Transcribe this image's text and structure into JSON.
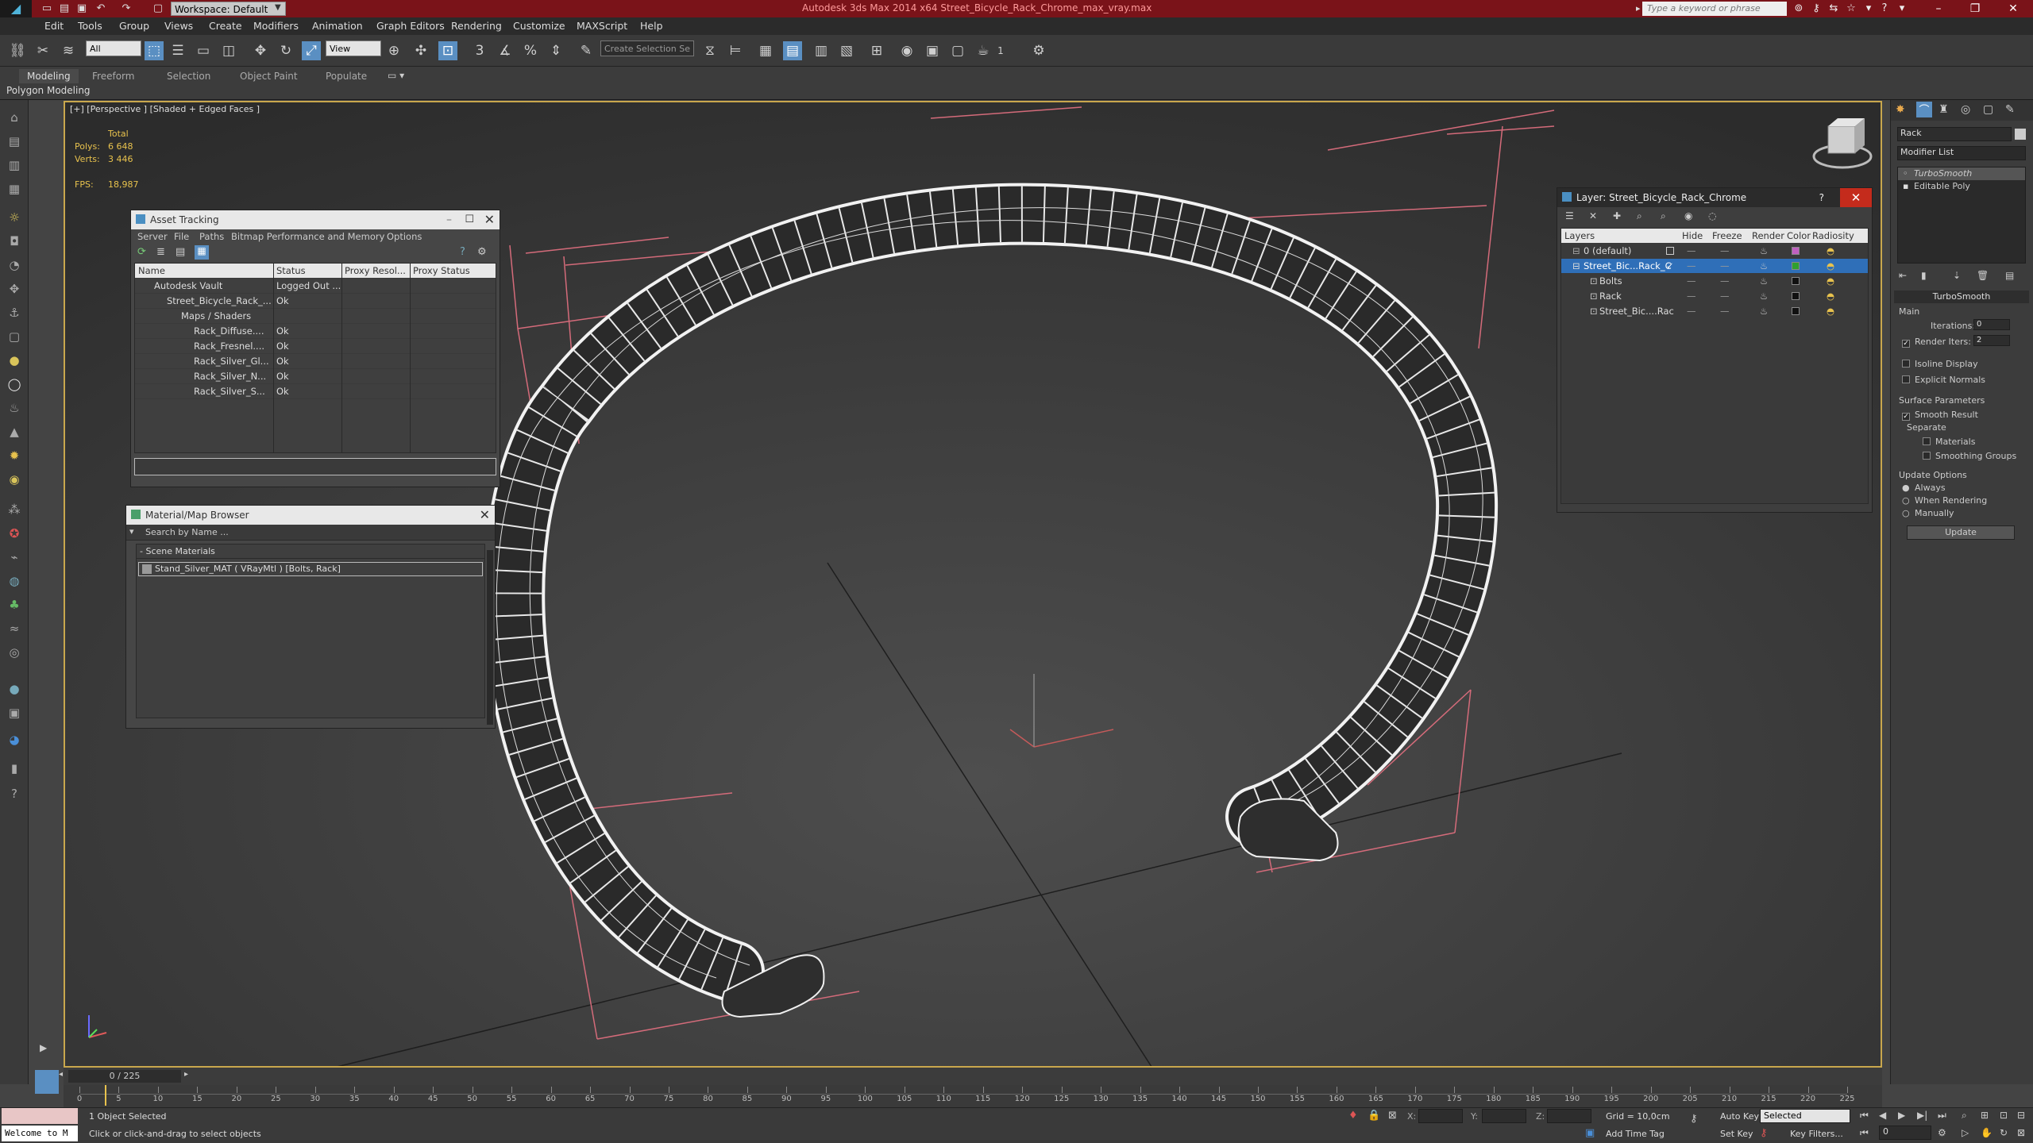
{
  "app": {
    "window_title": "Autodesk 3ds Max  2014 x64      Street_Bicycle_Rack_Chrome_max_vray.max",
    "workspace": "Workspace: Default",
    "search_placeholder": "Type a keyword or phrase"
  },
  "menu": [
    "Edit",
    "Tools",
    "Group",
    "Views",
    "Create",
    "Modifiers",
    "Animation",
    "Graph Editors",
    "Rendering",
    "Customize",
    "MAXScript",
    "Help"
  ],
  "toolbar": {
    "selection_filter": "All",
    "ref_coord": "View",
    "selection_set": "Create Selection Se",
    "snap_toggle": "3",
    "angle_snap": "%",
    "count": "1"
  },
  "ribbon": {
    "tabs": [
      "Modeling",
      "Freeform",
      "Selection",
      "Object Paint",
      "Populate"
    ],
    "sub_label": "Polygon Modeling"
  },
  "viewport": {
    "label": "[+] [Perspective ] [Shaded + Edged Faces ]",
    "stats": {
      "total_label": "Total",
      "polys_label": "Polys:",
      "polys_value": "6 648",
      "verts_label": "Verts:",
      "verts_value": "3 446",
      "fps_label": "FPS:",
      "fps_value": "18,987"
    }
  },
  "asset_tracking": {
    "title": "Asset Tracking",
    "menu": [
      "Server",
      "File",
      "Paths",
      "Bitmap Performance and Memory",
      "Options"
    ],
    "columns": [
      "Name",
      "Status",
      "Proxy Resol...",
      "Proxy Status"
    ],
    "rows": [
      {
        "name": "Autodesk Vault",
        "status": "Logged Out ..."
      },
      {
        "name": "Street_Bicycle_Rack_...",
        "status": "Ok"
      },
      {
        "name": "Maps / Shaders",
        "status": ""
      },
      {
        "name": "Rack_Diffuse....",
        "status": "Ok"
      },
      {
        "name": "Rack_Fresnel....",
        "status": "Ok"
      },
      {
        "name": "Rack_Silver_Gl...",
        "status": "Ok"
      },
      {
        "name": "Rack_Silver_N...",
        "status": "Ok"
      },
      {
        "name": "Rack_Silver_S...",
        "status": "Ok"
      }
    ]
  },
  "material_browser": {
    "title": "Material/Map Browser",
    "search_placeholder": "Search by Name ...",
    "group": "- Scene Materials",
    "item": "Stand_Silver_MAT  ( VRayMtl )  [Bolts, Rack]"
  },
  "layer_manager": {
    "title": "Layer: Street_Bicycle_Rack_Chrome",
    "help": "?",
    "columns": [
      "Layers",
      "Hide",
      "Freeze",
      "Render",
      "Color",
      "Radiosity"
    ],
    "rows": [
      {
        "name": "0 (default)",
        "color": "#c060c0"
      },
      {
        "name": "Street_Bic...Rack_C",
        "color": "#2fa02f"
      },
      {
        "name": "Bolts",
        "color": "#111111"
      },
      {
        "name": "Rack",
        "color": "#111111"
      },
      {
        "name": "Street_Bic....Rac",
        "color": "#111111"
      }
    ]
  },
  "command_panel": {
    "object_name": "Rack",
    "modifier_list": "Modifier List",
    "stack": [
      "TurboSmooth",
      "Editable Poly"
    ],
    "rollout_title": "TurboSmooth",
    "main_label": "Main",
    "iterations_label": "Iterations:",
    "iterations_value": "0",
    "render_iters_label": "Render Iters:",
    "render_iters_value": "2",
    "isoline": "Isoline Display",
    "explicit_normals": "Explicit Normals",
    "surface_params": "Surface Parameters",
    "smooth_result": "Smooth Result",
    "separate": "Separate",
    "materials": "Materials",
    "smoothing_groups": "Smoothing Groups",
    "update_options": "Update Options",
    "always": "Always",
    "when_rendering": "When Rendering",
    "manually": "Manually",
    "update_button": "Update"
  },
  "timeline": {
    "frame": "0 / 225",
    "ticks": [
      "0",
      "5",
      "10",
      "15",
      "20",
      "25",
      "30",
      "35",
      "40",
      "45",
      "50",
      "55",
      "60",
      "65",
      "70",
      "75",
      "80",
      "85",
      "90",
      "95",
      "100",
      "105",
      "110",
      "115",
      "120",
      "125",
      "130",
      "135",
      "140",
      "145",
      "150",
      "155",
      "160",
      "165",
      "170",
      "175",
      "180",
      "185",
      "190",
      "195",
      "200",
      "205",
      "210",
      "215",
      "220",
      "225"
    ]
  },
  "status": {
    "maxscript": "Welcome to M",
    "selected": "1 Object Selected",
    "prompt": "Click or click-and-drag to select objects",
    "x_label": "X:",
    "y_label": "Y:",
    "z_label": "Z:",
    "grid": "Grid = 10,0cm",
    "add_time_tag": "Add Time Tag",
    "auto_key": "Auto Key",
    "set_key": "Set Key",
    "selected_dropdown": "Selected",
    "key_filters": "Key Filters...",
    "frame_field": "0"
  }
}
